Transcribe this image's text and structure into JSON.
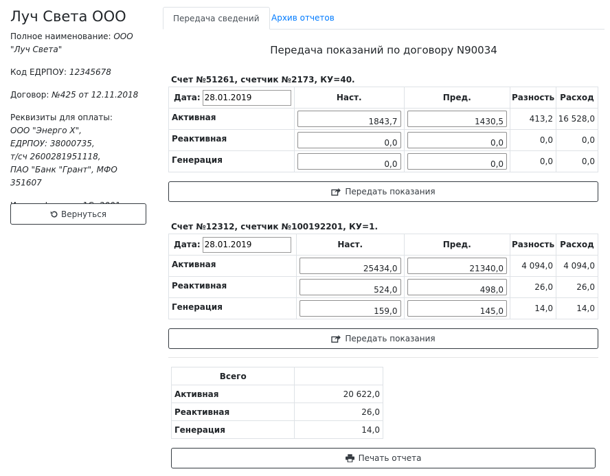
{
  "company": {
    "title": "Луч Света ООО",
    "full_name_label": "Полное наименование: ",
    "full_name": "ООО \"Луч Света\"",
    "edrpou_label": "Код ЕДРПОУ: ",
    "edrpou": "12345678",
    "contract_label": "Договор: ",
    "contract": "№425 от 12.11.2018",
    "payment_label": "Реквизиты для оплаты:",
    "payment_lines": [
      "ООО \"Энерго Х\",",
      "ЕДРПОУ: 38000735,",
      "т/сч 2600281951118,",
      "ПАО \"Банк \"Грант\", МФО 351607"
    ],
    "id1c_label": "Идентификатор 1С: ",
    "id1c": "2001",
    "back_label": "Вернуться"
  },
  "tabs": [
    {
      "label": "Передача сведений"
    },
    {
      "label": "Архив отчетов"
    }
  ],
  "page_title": "Передача показаний по договору N90034",
  "columns": {
    "date_label": "Дата:",
    "current": "Наст.",
    "previous": "Пред.",
    "difference": "Разность",
    "consumption": "Расход"
  },
  "meters": [
    {
      "heading": "Счет №51261, счетчик №2173, КУ=40.",
      "date": "28.01.2019",
      "rows": [
        {
          "label": "Активная",
          "current": "1843,7",
          "previous": "1430,5",
          "difference": "413,2",
          "consumption": "16 528,0"
        },
        {
          "label": "Реактивная",
          "current": "0,0",
          "previous": "0,0",
          "difference": "0,0",
          "consumption": "0,0"
        },
        {
          "label": "Генерация",
          "current": "0,0",
          "previous": "0,0",
          "difference": "0,0",
          "consumption": "0,0"
        }
      ],
      "submit_label": "Передать показания"
    },
    {
      "heading": "Счет №12312, счетчик №100192201, КУ=1.",
      "date": "28.01.2019",
      "rows": [
        {
          "label": "Активная",
          "current": "25434,0",
          "previous": "21340,0",
          "difference": "4 094,0",
          "consumption": "4 094,0"
        },
        {
          "label": "Реактивная",
          "current": "524,0",
          "previous": "498,0",
          "difference": "26,0",
          "consumption": "26,0"
        },
        {
          "label": "Генерация",
          "current": "159,0",
          "previous": "145,0",
          "difference": "14,0",
          "consumption": "14,0"
        }
      ],
      "submit_label": "Передать показания"
    }
  ],
  "totals": {
    "header": "Всего",
    "rows": [
      {
        "label": "Активная",
        "value": "20 622,0"
      },
      {
        "label": "Реактивная",
        "value": "26,0"
      },
      {
        "label": "Генерация",
        "value": "14,0"
      }
    ]
  },
  "print_label": "Печать отчета",
  "icons": {
    "back": "undo-icon",
    "submit": "share-square-icon",
    "print": "print-icon"
  }
}
